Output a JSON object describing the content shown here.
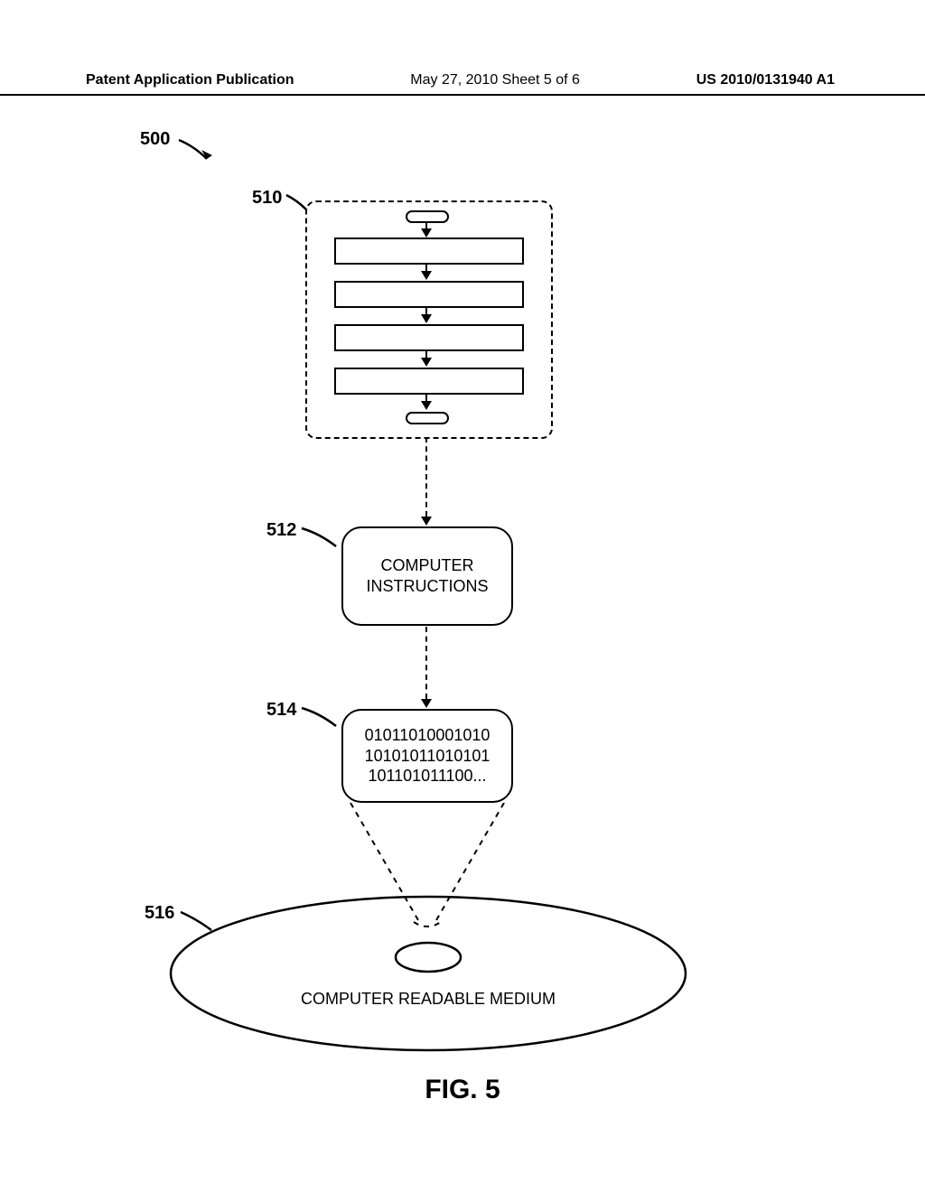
{
  "header": {
    "left": "Patent Application Publication",
    "center": "May 27, 2010  Sheet 5 of 6",
    "right": "US 2010/0131940 A1"
  },
  "refs": {
    "r500": "500",
    "r510": "510",
    "r512": "512",
    "r514": "514",
    "r516": "516"
  },
  "boxes": {
    "instructions": "COMPUTER\nINSTRUCTIONS",
    "binary_line1": "01011010001010",
    "binary_line2": "10101011010101",
    "binary_line3": "101101011100..."
  },
  "disc": {
    "label": "COMPUTER READABLE MEDIUM"
  },
  "figure": "FIG. 5"
}
